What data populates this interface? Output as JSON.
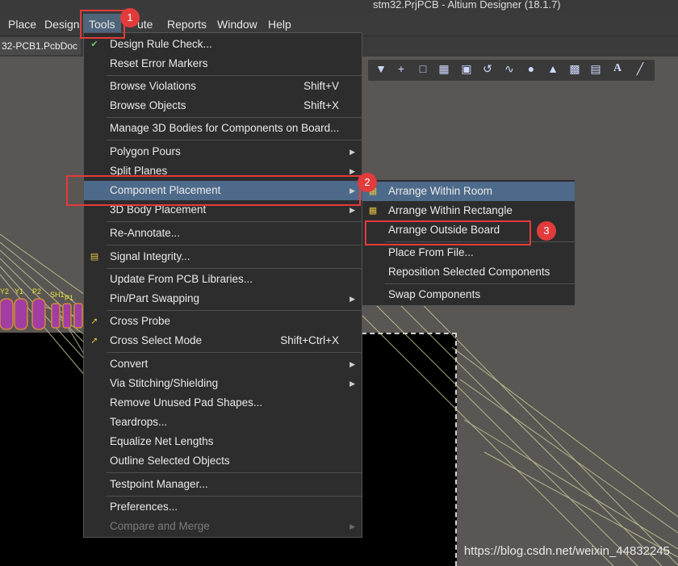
{
  "window": {
    "title": "stm32.PrjPCB - Altium Designer (18.1.7)"
  },
  "menubar": {
    "items": [
      "Place",
      "Design",
      "Tools",
      "Route",
      "Reports",
      "Window",
      "Help"
    ],
    "visible_items": [
      "Place",
      "Design",
      "Tools",
      "ute",
      "Reports",
      "Window",
      "Help"
    ],
    "active": "Tools"
  },
  "tab": {
    "label": "32-PCB1.PcbDoc *"
  },
  "tools_menu": {
    "items": [
      {
        "label": "Design Rule Check...",
        "shortcut": "",
        "submenu": false
      },
      {
        "label": "Reset Error Markers",
        "shortcut": "",
        "submenu": false
      },
      {
        "label": "Browse Violations",
        "shortcut": "Shift+V",
        "submenu": false
      },
      {
        "label": "Browse Objects",
        "shortcut": "Shift+X",
        "submenu": false
      },
      {
        "label": "Manage 3D Bodies for Components on Board...",
        "shortcut": "",
        "submenu": false
      },
      {
        "label": "Polygon Pours",
        "shortcut": "",
        "submenu": true
      },
      {
        "label": "Split Planes",
        "shortcut": "",
        "submenu": true
      },
      {
        "label": "Component Placement",
        "shortcut": "",
        "submenu": true
      },
      {
        "label": "3D Body Placement",
        "shortcut": "",
        "submenu": true
      },
      {
        "label": "Re-Annotate...",
        "shortcut": "",
        "submenu": false
      },
      {
        "label": "Signal Integrity...",
        "shortcut": "",
        "submenu": false
      },
      {
        "label": "Update From PCB Libraries...",
        "shortcut": "",
        "submenu": false
      },
      {
        "label": "Pin/Part Swapping",
        "shortcut": "",
        "submenu": true
      },
      {
        "label": "Cross Probe",
        "shortcut": "",
        "submenu": false
      },
      {
        "label": "Cross Select Mode",
        "shortcut": "Shift+Ctrl+X",
        "submenu": false
      },
      {
        "label": "Convert",
        "shortcut": "",
        "submenu": true
      },
      {
        "label": "Via Stitching/Shielding",
        "shortcut": "",
        "submenu": true
      },
      {
        "label": "Remove Unused Pad Shapes...",
        "shortcut": "",
        "submenu": false
      },
      {
        "label": "Teardrops...",
        "shortcut": "",
        "submenu": false
      },
      {
        "label": "Equalize Net Lengths",
        "shortcut": "",
        "submenu": false
      },
      {
        "label": "Outline Selected Objects",
        "shortcut": "",
        "submenu": false
      },
      {
        "label": "Testpoint Manager...",
        "shortcut": "",
        "submenu": false
      },
      {
        "label": "Preferences...",
        "shortcut": "",
        "submenu": false
      },
      {
        "label": "Compare and Merge",
        "shortcut": "",
        "submenu": true,
        "disabled": true
      }
    ]
  },
  "placement_submenu": {
    "items": [
      {
        "label": "Arrange Within Room"
      },
      {
        "label": "Arrange Within Rectangle"
      },
      {
        "label": "Arrange Outside Board"
      },
      {
        "label": "Place From File..."
      },
      {
        "label": "Reposition Selected Components"
      },
      {
        "label": "Swap Components"
      }
    ]
  },
  "callouts": [
    "1",
    "2",
    "3"
  ],
  "pcb_labels": [
    "Y2",
    "Y1",
    "P2",
    "SH1",
    "P1"
  ],
  "watermark": "https://blog.csdn.net/weixin_44832245",
  "colors": {
    "highlight": "#4e6a8a",
    "callout": "#e23b3b",
    "menu_bg": "#2d2d2d"
  }
}
